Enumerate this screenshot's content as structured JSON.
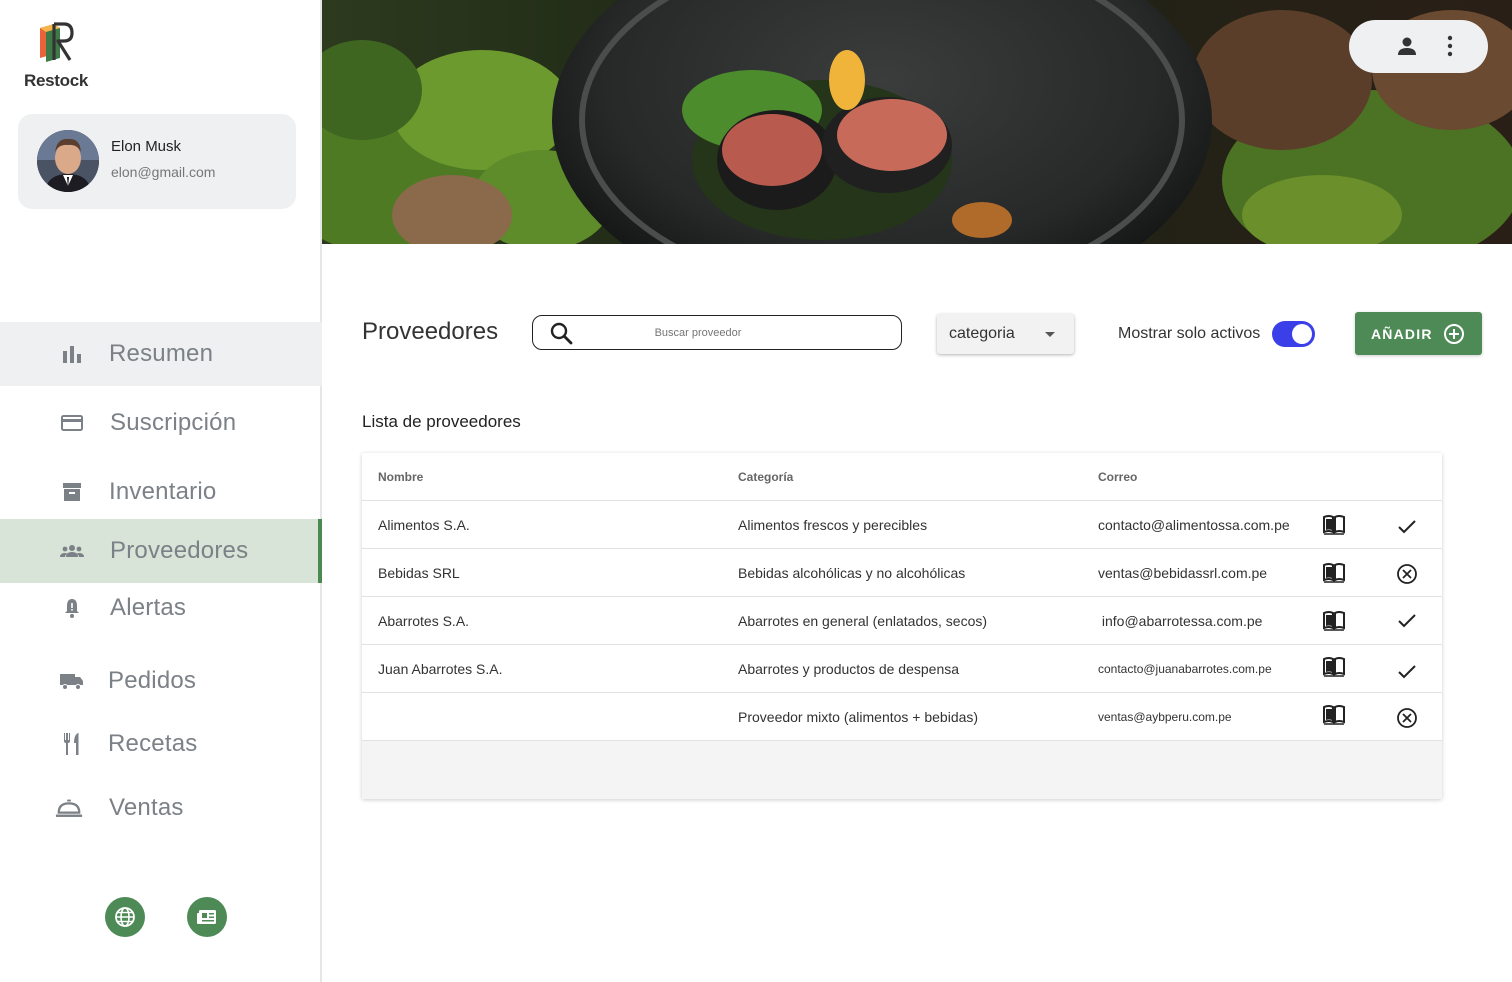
{
  "app": {
    "name": "Restock"
  },
  "user": {
    "name": "Elon Musk",
    "email": "elon@gmail.com"
  },
  "sidebar": {
    "items": [
      {
        "label": "Resumen",
        "icon": "bar-chart-icon"
      },
      {
        "label": "Suscripción",
        "icon": "credit-card-icon"
      },
      {
        "label": "Inventario",
        "icon": "archive-box-icon"
      },
      {
        "label": "Proveedores",
        "icon": "people-icon"
      },
      {
        "label": "Alertas",
        "icon": "bell-icon"
      },
      {
        "label": "Pedidos",
        "icon": "truck-icon"
      },
      {
        "label": "Recetas",
        "icon": "fork-knife-icon"
      },
      {
        "label": "Ventas",
        "icon": "service-bell-icon"
      }
    ],
    "active": "Proveedores",
    "footer_buttons": [
      "globe-icon",
      "newspaper-icon"
    ]
  },
  "topbar": {
    "icons": [
      "person-icon",
      "more-vertical-icon"
    ]
  },
  "toolbar": {
    "title": "Proveedores",
    "search_placeholder": "Buscar proveedor",
    "category_value": "categoria",
    "toggle_label": "Mostrar solo activos",
    "toggle_on": true,
    "add_label": "AÑADIR"
  },
  "list": {
    "title": "Lista de proveedores",
    "columns": [
      "Nombre",
      "Categoría",
      "Correo"
    ],
    "rows": [
      {
        "name": "Alimentos S.A.",
        "category": "Alimentos frescos y perecibles",
        "email": "contacto@alimentossa.com.pe",
        "active": true
      },
      {
        "name": "Bebidas SRL",
        "category": "Bebidas alcohólicas y no alcohólicas",
        "email": "ventas@bebidassrl.com.pe",
        "active": false
      },
      {
        "name": "Abarrotes S.A.",
        "category": "Abarrotes en general (enlatados, secos)",
        "email": " info@abarrotessa.com.pe",
        "active": true
      },
      {
        "name": "Juan Abarrotes S.A.",
        "category": "Abarrotes y productos de despensa",
        "email": "contacto@juanabarrotes.com.pe",
        "active": true
      },
      {
        "name": "",
        "category": "Proveedor mixto (alimentos + bebidas)",
        "email": "ventas@aybperu.com.pe",
        "active": false
      }
    ]
  },
  "colors": {
    "primary_green": "#4d8a55",
    "active_nav_bg": "#d7e4d7",
    "toggle_blue": "#3b3fe8"
  }
}
